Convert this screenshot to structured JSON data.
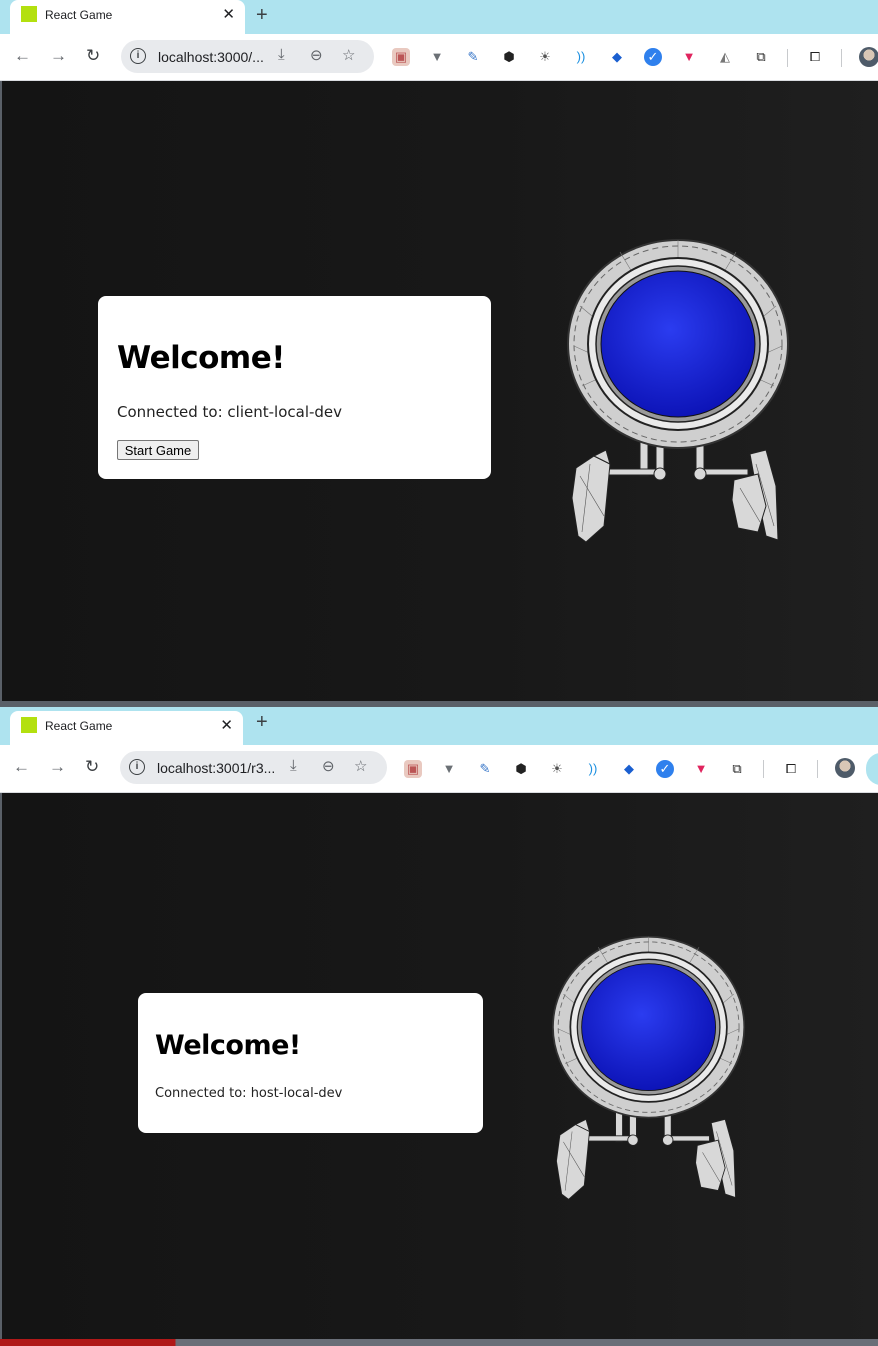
{
  "windows": [
    {
      "tab_title": "React Game",
      "tab_close": "✕",
      "new_tab": "+",
      "url": "localhost:3000/...",
      "card": {
        "heading": "Welcome!",
        "connection_text": "Connected to: client-local-dev",
        "start_button": "Start Game"
      }
    },
    {
      "tab_title": "React Game",
      "tab_close": "✕",
      "new_tab": "+",
      "url": "localhost:3001/r3...",
      "card": {
        "heading": "Welcome!",
        "connection_text": "Connected to: host-local-dev"
      }
    }
  ],
  "toolbar_icons": {
    "back": "←",
    "forward": "→",
    "reload": "↻",
    "info": "i",
    "install": "⤓",
    "zoom": "⊖",
    "bookmark": "☆"
  },
  "extensions": [
    "pictures-icon",
    "v-icon",
    "feather-icon",
    "cube-icon",
    "sun-icon",
    "wave-icon",
    "diamond-icon",
    "check-icon",
    "gem-icon",
    "triangle-icon",
    "puzzle-icon",
    "reading-list-icon"
  ],
  "colors": {
    "tabstrip": "#aee3ef",
    "favicon": "#b3e00f",
    "page_bg": "#151515",
    "robot_lens": "#1420d8",
    "robot_shell": "#d8d8d8"
  }
}
